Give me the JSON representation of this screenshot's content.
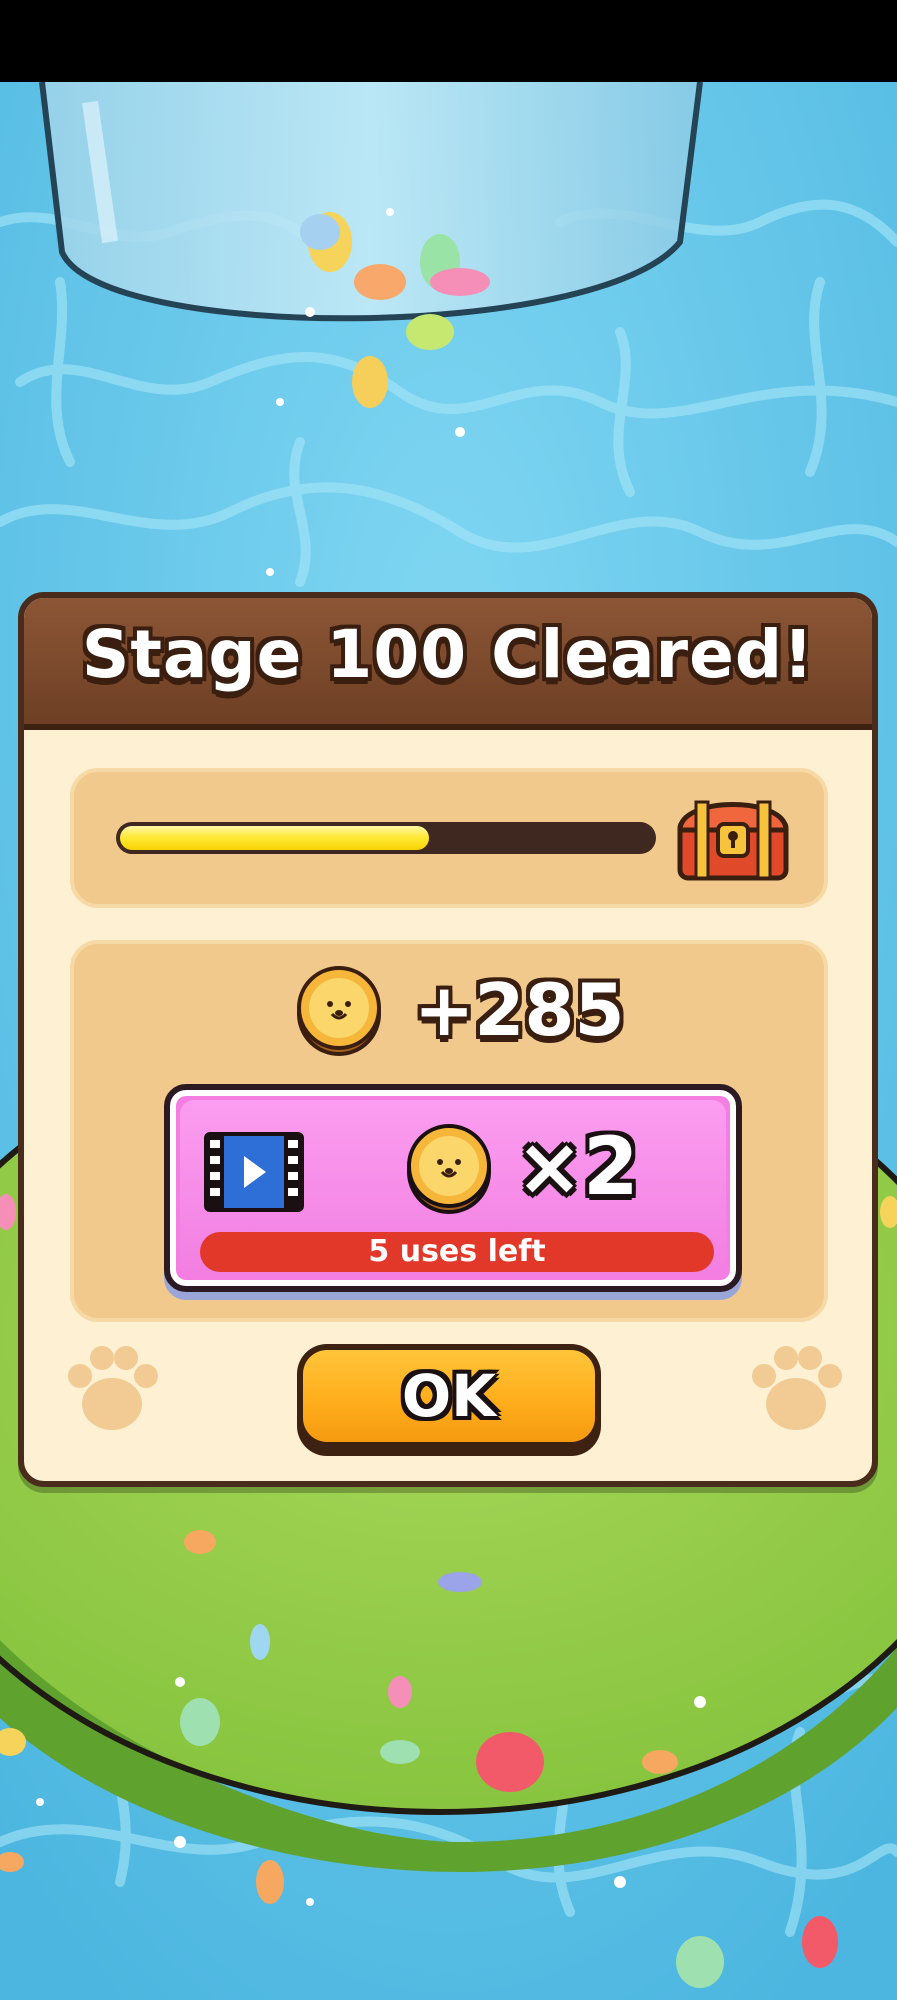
{
  "dialog": {
    "title": "Stage 100 Cleared!",
    "progress": 0.58,
    "reward_amount": "+285",
    "ad_bonus": {
      "multiplier": "×2",
      "uses_left": "5 uses left"
    },
    "ok_label": "OK"
  },
  "icons": {
    "chest": "treasure-chest-icon",
    "coin": "coin-icon",
    "video": "video-ad-icon",
    "paw": "paw-print-icon"
  },
  "colors": {
    "header": "#7a4729",
    "panel": "#fdf0d3",
    "box": "#f2c98c",
    "progress_fill": "#ffea3a",
    "ad_button": "#f57ee2",
    "uses_bar": "#e1382a",
    "ok_button": "#ffae1c"
  }
}
